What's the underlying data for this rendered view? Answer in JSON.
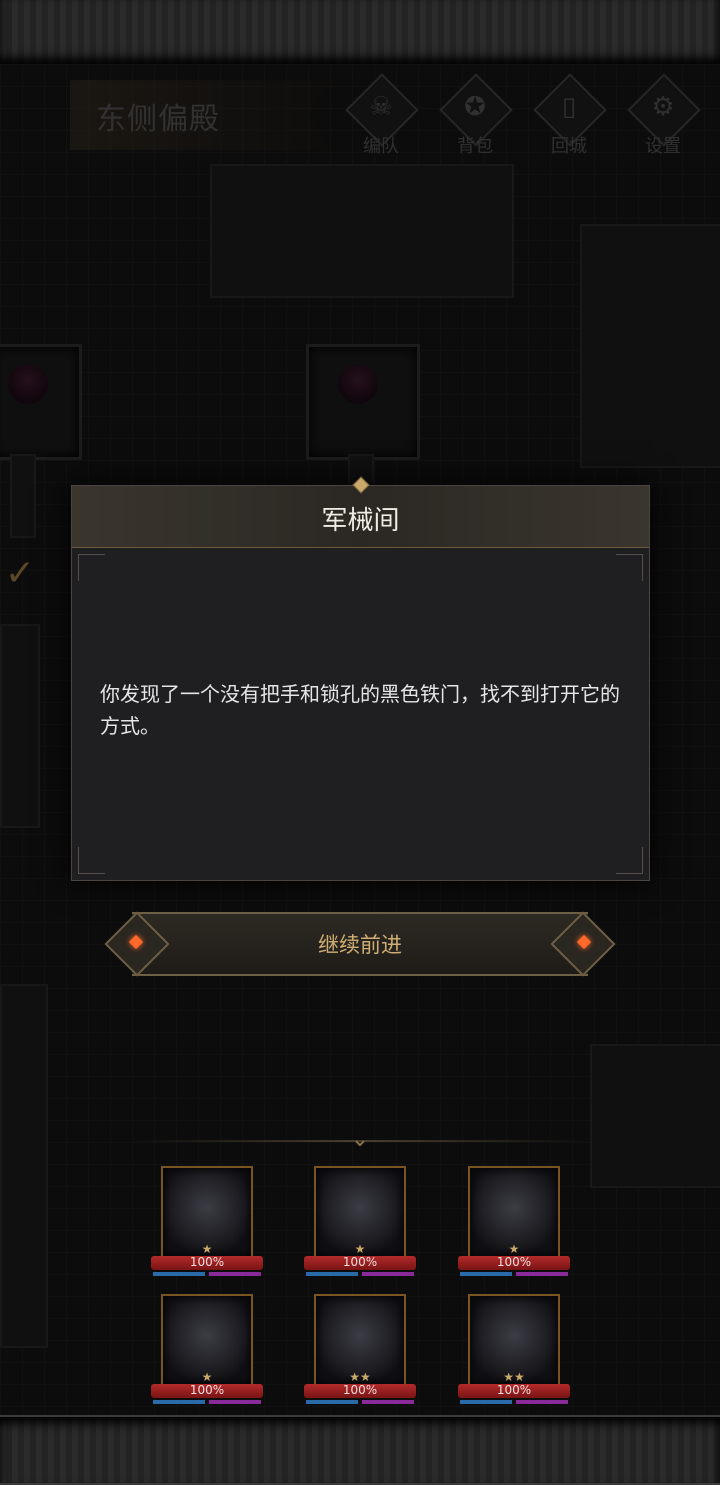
{
  "location": {
    "title": "东侧偏殿"
  },
  "top_menu": [
    {
      "id": "team",
      "label": "编队",
      "icon": "horned-skull-icon"
    },
    {
      "id": "bag",
      "label": "背包",
      "icon": "bag-icon"
    },
    {
      "id": "return",
      "label": "回城",
      "icon": "door-icon"
    },
    {
      "id": "settings",
      "label": "设置",
      "icon": "gear-icon"
    }
  ],
  "dialog": {
    "title": "军械间",
    "body": "你发现了一个没有把手和锁孔的黑色铁门，找不到打开它的方式。"
  },
  "continue_button": {
    "label": "继续前进"
  },
  "heroes": [
    {
      "hp": "100%",
      "stars": "★"
    },
    {
      "hp": "100%",
      "stars": "★"
    },
    {
      "hp": "100%",
      "stars": "★"
    },
    {
      "hp": "100%",
      "stars": "★"
    },
    {
      "hp": "100%",
      "stars": "★★"
    },
    {
      "hp": "100%",
      "stars": "★★"
    }
  ],
  "colors": {
    "accent_gold": "#cfae74",
    "hp_red": "#b32a2a",
    "mana_blue": "#2a6aa8",
    "energy_purple": "#8a2a9a"
  }
}
